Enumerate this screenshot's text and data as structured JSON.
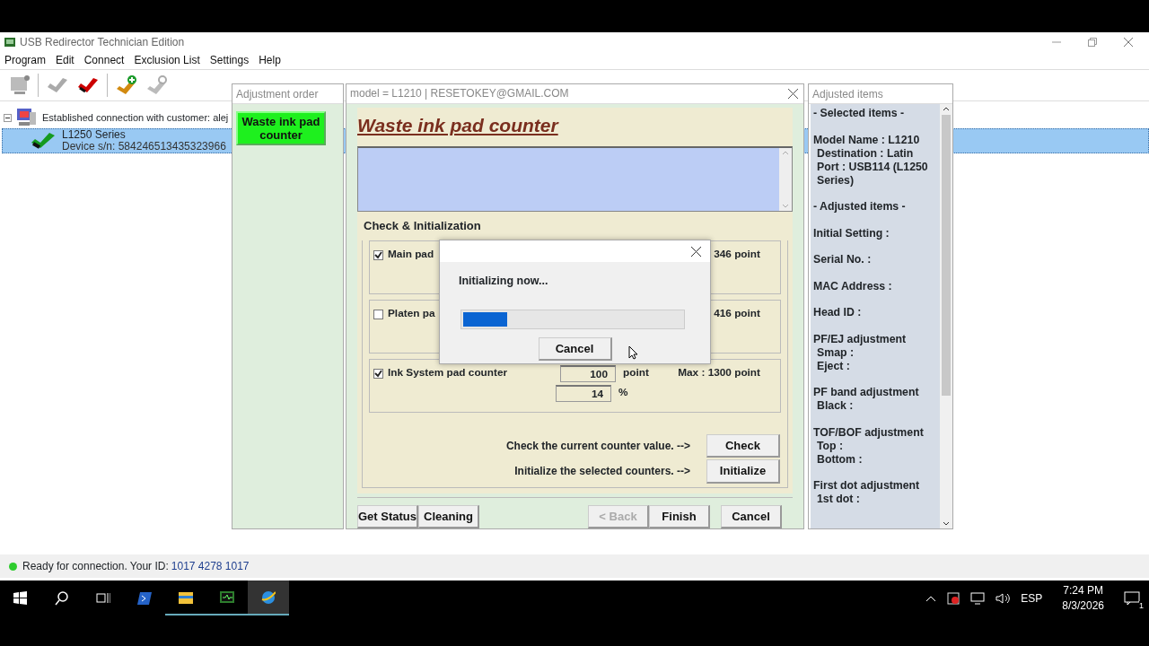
{
  "app": {
    "title": "USB Redirector Technician Edition",
    "menu": [
      "Program",
      "Edit",
      "Connect",
      "Exclusion List",
      "Settings",
      "Help"
    ],
    "tree": {
      "label": "Established connection with customer: alej",
      "expanded": true,
      "children": [
        {
          "name": "L1250 Series",
          "detail": "Device s/n: 584246513435323966",
          "selected": true
        }
      ]
    },
    "status": {
      "text": "Ready for connection. Your ID:",
      "id": "1017 4278 1017",
      "online": true
    }
  },
  "adjustment_order": {
    "title": "Adjustment order",
    "items": [
      {
        "label": "Waste ink pad counter",
        "selected": true
      }
    ]
  },
  "dialog": {
    "title": "model = L1210 | RESETOKEY@GMAIL.COM",
    "heading": "Waste ink pad counter",
    "group": "Check & Initialization",
    "counters": [
      {
        "label": "Main pad",
        "checked": true,
        "reading": "346 point"
      },
      {
        "label": "Platen pa",
        "checked": false,
        "reading": "416 point"
      },
      {
        "label": "Ink System pad counter",
        "checked": true,
        "value": "100",
        "unit": "point",
        "reading": "Max : 1300 point",
        "percent": "14",
        "percent_unit": "%"
      }
    ],
    "actions": [
      {
        "text": "Check the current counter value. -->",
        "button": "Check"
      },
      {
        "text": "Initialize the selected counters. -->",
        "button": "Initialize"
      }
    ],
    "buttons": [
      {
        "label": "Get Status",
        "disabled": false
      },
      {
        "label": "Cleaning",
        "disabled": false
      },
      {
        "label": "< Back",
        "disabled": true
      },
      {
        "label": "Finish",
        "disabled": false
      },
      {
        "label": "Cancel",
        "disabled": false
      }
    ]
  },
  "adjusted_items": {
    "title": "Adjusted items",
    "blocks": [
      {
        "heading": "- Selected items -"
      },
      {
        "heading": "Model Name : L1210",
        "fields": [
          "Destination : Latin",
          "Port : USB114 (L1250 Series)"
        ]
      },
      {
        "heading": "- Adjusted items -"
      },
      {
        "heading": "Initial Setting :"
      },
      {
        "heading": "Serial No. :"
      },
      {
        "heading": "MAC Address :"
      },
      {
        "heading": "Head ID :"
      },
      {
        "heading": "PF/EJ adjustment",
        "fields": [
          "Smap :",
          "Eject :"
        ]
      },
      {
        "heading": "PF band adjustment",
        "fields": [
          "Black :"
        ]
      },
      {
        "heading": "TOF/BOF adjustment",
        "fields": [
          "Top :",
          "Bottom :"
        ]
      },
      {
        "heading": "First dot adjustment",
        "fields": [
          "1st dot :"
        ]
      }
    ]
  },
  "progress": {
    "message": "Initializing now...",
    "level": 0.2,
    "button": "Cancel"
  },
  "taskbar": {
    "language": "ESP",
    "time": "7:24 PM",
    "date": "8/3/2026",
    "notifications": "1"
  }
}
